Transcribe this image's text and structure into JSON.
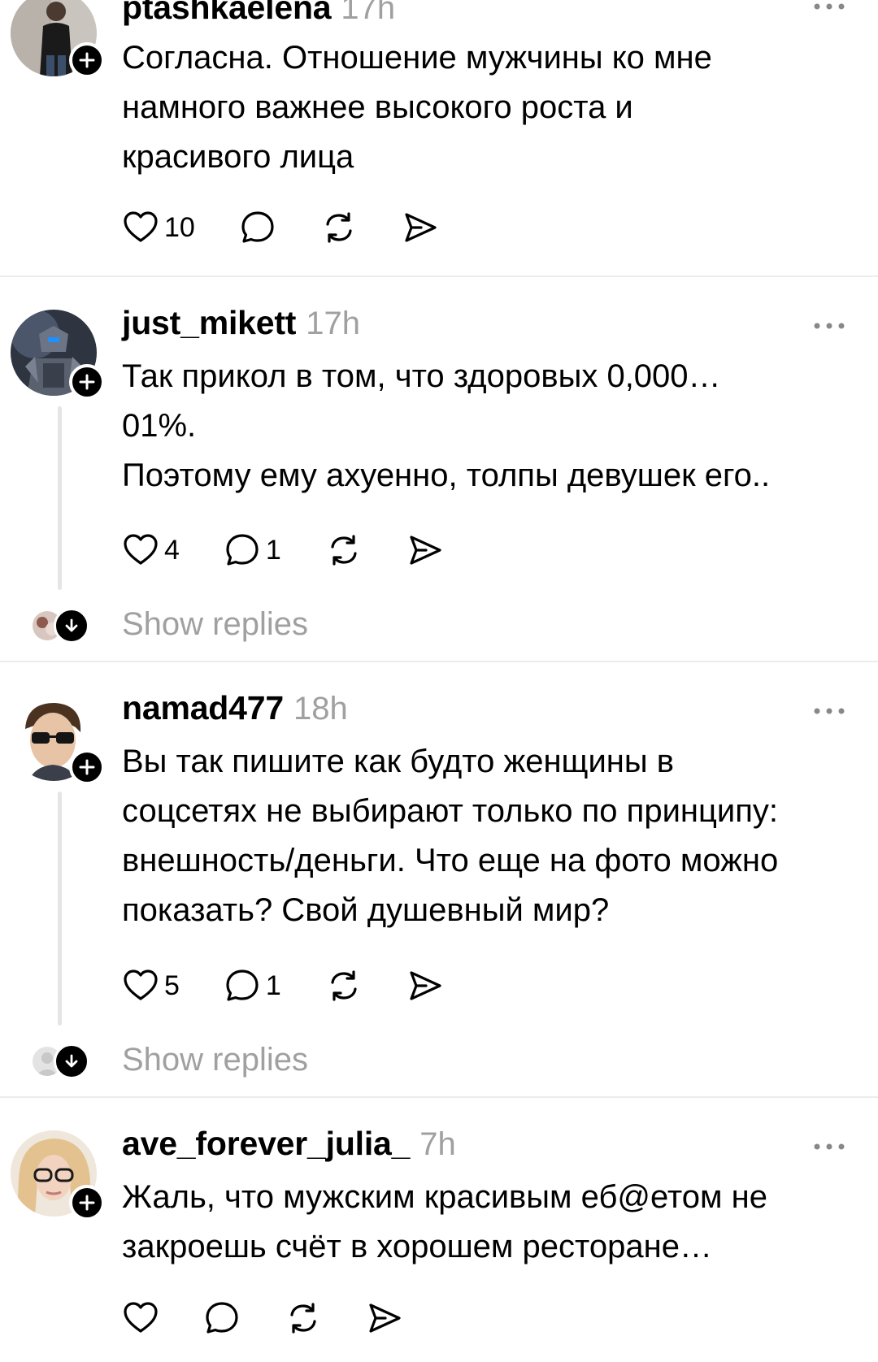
{
  "comments": [
    {
      "username": "ptashkaelena",
      "time": "17h",
      "text": "Согласна. Отношение мужчины ко мне\nнамного важнее высокого роста и\nкрасивого лица",
      "likes": "10",
      "replies_count": "",
      "show_replies": ""
    },
    {
      "username": "just_mikett",
      "time": "17h",
      "text": "Так прикол в том, что здоровых 0,000…\n01%.\nПоэтому ему ахуенно, толпы девушек его..",
      "likes": "4",
      "replies_count": "1",
      "show_replies": "Show replies"
    },
    {
      "username": "namad477",
      "time": "18h",
      "text": "Вы так пишите как будто женщины в\nсоцсетях не выбирают только по принципу:\nвнешность/деньги. Что еще на фото можно\nпоказать? Свой душевный мир?",
      "likes": "5",
      "replies_count": "1",
      "show_replies": "Show replies"
    },
    {
      "username": "ave_forever_julia_",
      "time": "7h",
      "text": "Жаль, что мужским красивым еб@етом не\nзакроешь счёт в хорошем ресторане…",
      "likes": "",
      "replies_count": "",
      "show_replies": ""
    }
  ],
  "icons": {
    "like": "heart-icon",
    "reply": "speech-bubble-icon",
    "repost": "repost-icon",
    "share": "send-icon",
    "more": "more-dots-icon",
    "follow": "plus-icon",
    "expand": "arrow-down-icon"
  },
  "colors": {
    "text": "#000000",
    "muted": "#a0a0a0",
    "divider": "#ececec",
    "thread_line": "#e5e5e5"
  }
}
